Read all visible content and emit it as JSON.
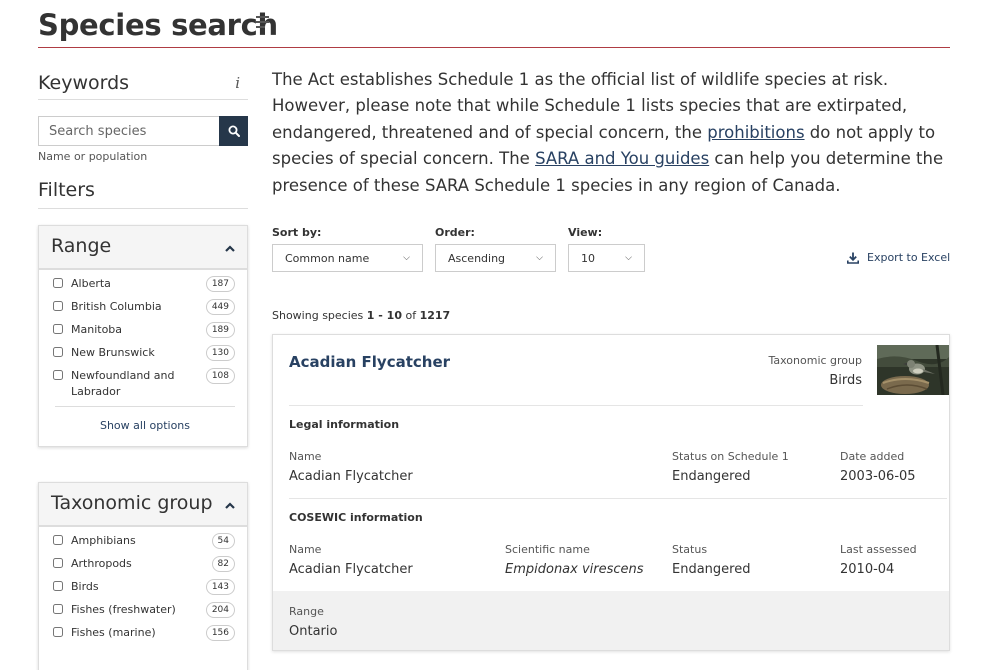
{
  "header": {
    "title": "Species search"
  },
  "sidebar": {
    "keywords_title": "Keywords",
    "info_icon": "i",
    "search": {
      "placeholder": "Search species",
      "hint": "Name or population"
    },
    "filters_title": "Filters",
    "range": {
      "title": "Range",
      "items": [
        {
          "label": "Alberta",
          "count": "187"
        },
        {
          "label": "British Columbia",
          "count": "449"
        },
        {
          "label": "Manitoba",
          "count": "189"
        },
        {
          "label": "New Brunswick",
          "count": "130"
        },
        {
          "label": "Newfoundland and Labrador",
          "count": "108"
        }
      ],
      "show_all": "Show all options"
    },
    "taxonomic_group": {
      "title": "Taxonomic group",
      "items": [
        {
          "label": "Amphibians",
          "count": "54"
        },
        {
          "label": "Arthropods",
          "count": "82"
        },
        {
          "label": "Birds",
          "count": "143"
        },
        {
          "label": "Fishes (freshwater)",
          "count": "204"
        },
        {
          "label": "Fishes (marine)",
          "count": "156"
        }
      ]
    }
  },
  "intro": {
    "part1": "The Act establishes Schedule 1 as the official list of wildlife species at risk. However, please note that while Schedule 1 lists species that are extirpated, endangered, threatened and of special concern, the ",
    "link1": "prohibitions",
    "part2": " do not apply to species of special concern. The ",
    "link2": "SARA and You guides",
    "part3": " can help you determine the presence of these SARA Schedule 1 species in any region of Canada."
  },
  "controls": {
    "sort_label": "Sort by:",
    "sort_value": "Common name",
    "order_label": "Order:",
    "order_value": "Ascending",
    "view_label": "View:",
    "view_value": "10",
    "export_label": "Export to Excel"
  },
  "results": {
    "showing_prefix": "Showing species ",
    "range_text": "1 - 10",
    "of_text": " of ",
    "total": "1217"
  },
  "card": {
    "name": "Acadian Flycatcher",
    "taxo_label": "Taxonomic group",
    "taxo_value": "Birds",
    "legal": {
      "title": "Legal information",
      "name_label": "Name",
      "name_value": "Acadian Flycatcher",
      "status_label": "Status on Schedule 1",
      "status_value": "Endangered",
      "date_label": "Date added",
      "date_value": "2003-06-05"
    },
    "cosewic": {
      "title": "COSEWIC information",
      "name_label": "Name",
      "name_value": "Acadian Flycatcher",
      "sci_label": "Scientific name",
      "sci_value": "Empidonax virescens",
      "status_label": "Status",
      "status_value": "Endangered",
      "assessed_label": "Last assessed",
      "assessed_value": "2010-04"
    },
    "range": {
      "label": "Range",
      "value": "Ontario"
    }
  },
  "colors": {
    "navy": "#26374a",
    "link": "#284162",
    "rule": "#af3c43"
  }
}
